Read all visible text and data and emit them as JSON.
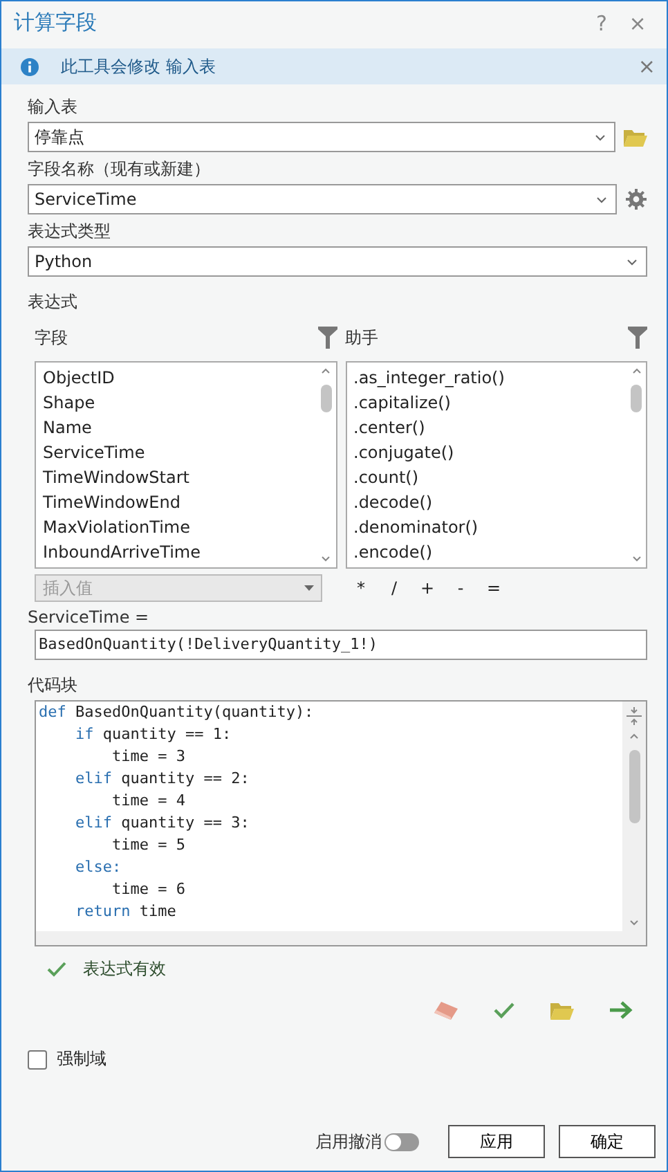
{
  "window": {
    "title": "计算字段",
    "help": "?",
    "close": "×"
  },
  "info_bar": {
    "message": "此工具会修改 输入表",
    "close": "×"
  },
  "input_table": {
    "label": "输入表",
    "value": "停靠点"
  },
  "field_name": {
    "label": "字段名称（现有或新建）",
    "value": "ServiceTime"
  },
  "expression_type": {
    "label": "表达式类型",
    "value": "Python"
  },
  "expression": {
    "label": "表达式",
    "fields": {
      "label": "字段",
      "items": [
        {
          "text": "ObjectID",
          "selected": false
        },
        {
          "text": "Shape",
          "selected": false
        },
        {
          "text": "Name",
          "selected": false
        },
        {
          "text": "ServiceTime",
          "selected": false
        },
        {
          "text": "TimeWindowStart",
          "selected": false
        },
        {
          "text": "TimeWindowEnd",
          "selected": false
        },
        {
          "text": "MaxViolationTime",
          "selected": false
        },
        {
          "text": "InboundArriveTime",
          "selected": false
        }
      ]
    },
    "helpers": {
      "label": "助手",
      "items": [
        {
          "text": ".as_integer_ratio()",
          "selected": false
        },
        {
          "text": ".capitalize()",
          "selected": false
        },
        {
          "text": ".center()",
          "selected": false
        },
        {
          "text": ".conjugate()",
          "selected": false
        },
        {
          "text": ".count()",
          "selected": false
        },
        {
          "text": ".decode()",
          "selected": false
        },
        {
          "text": ".denominator()",
          "selected": false
        },
        {
          "text": ".encode()",
          "selected": false
        }
      ]
    },
    "insert_value": {
      "placeholder": "插入值",
      "disabled": true
    },
    "operators": [
      "*",
      "/",
      "+",
      "-",
      "="
    ],
    "target_label": "ServiceTime =",
    "value": "BasedOnQuantity(!DeliveryQuantity_1!)"
  },
  "code_block": {
    "label": "代码块",
    "lines": [
      {
        "kind": "keyword",
        "text": "def BasedOnQuantity(quantity):"
      },
      {
        "kind": "keyword",
        "text": "    if quantity == 1:"
      },
      {
        "kind": "plain",
        "text": "        time = 3"
      },
      {
        "kind": "keyword",
        "text": "    elif quantity == 2:"
      },
      {
        "kind": "plain",
        "text": "        time = 4"
      },
      {
        "kind": "keyword",
        "text": "    elif quantity == 3:"
      },
      {
        "kind": "plain",
        "text": "        time = 5"
      },
      {
        "kind": "keyword",
        "text": "    else:"
      },
      {
        "kind": "plain",
        "text": "        time = 6"
      },
      {
        "kind": "keyword",
        "text": "    return time"
      }
    ]
  },
  "validation": {
    "valid": true,
    "message": "表达式有效"
  },
  "enforce_domains": {
    "label": "强制域",
    "checked": false
  },
  "footer": {
    "undo_label": "启用撤消",
    "undo_on": false,
    "buttons": [
      "应用",
      "确定"
    ]
  }
}
